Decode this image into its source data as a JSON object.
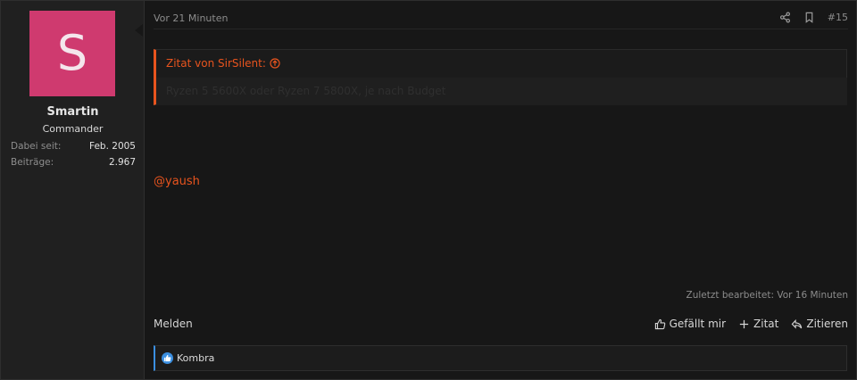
{
  "user": {
    "avatar_letter": "S",
    "avatar_color": "#cf3a6f",
    "name": "Smartin",
    "title": "Commander",
    "stats": [
      {
        "label": "Dabei seit:",
        "value": "Feb. 2005"
      },
      {
        "label": "Beiträge:",
        "value": "2.967"
      }
    ]
  },
  "post": {
    "time": "Vor 21 Minuten",
    "number": "#15",
    "icons": [
      "share-icon",
      "bookmark-icon"
    ],
    "quote": {
      "title": "Zitat von SirSilent:",
      "text": "Ryzen 5 5600X oder Ryzen 7 5800X, je nach Budget"
    },
    "mention": "@yaush",
    "edited": "Zuletzt bearbeitet: Vor 16 Minuten",
    "report_label": "Melden",
    "actions": [
      {
        "icon": "thumbs-up-icon",
        "label": "Gefällt mir"
      },
      {
        "icon": "plus-icon",
        "label": "Zitat"
      },
      {
        "icon": "reply-icon",
        "label": "Zitieren"
      }
    ],
    "reactions": {
      "icon": "like-reaction-icon",
      "users": "Kombra"
    }
  },
  "colors": {
    "accent": "#e8541e",
    "like": "#3b8fe0",
    "background": "#171717",
    "sidebar": "#202020"
  }
}
